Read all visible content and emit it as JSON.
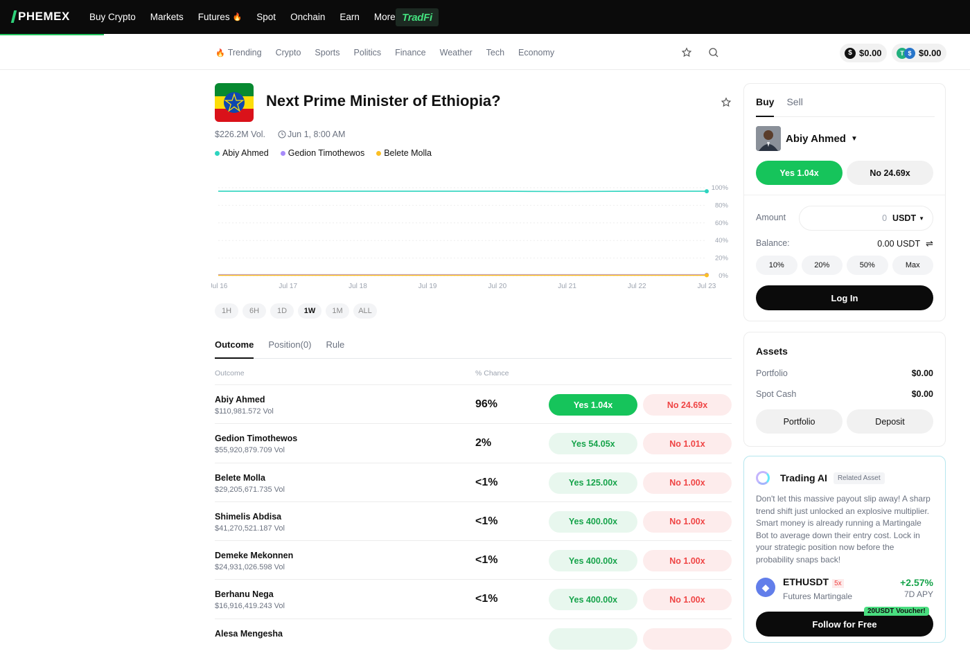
{
  "topnav": {
    "logo": "PHEMEX",
    "links": [
      "Buy Crypto",
      "Markets",
      "Futures",
      "Spot",
      "Onchain",
      "Earn",
      "More"
    ],
    "tradfi": "TradFi"
  },
  "subnav": {
    "categories": [
      "Trending",
      "Crypto",
      "Sports",
      "Politics",
      "Finance",
      "Weather",
      "Tech",
      "Economy"
    ],
    "balance1": "$0.00",
    "balance2": "$0.00"
  },
  "market": {
    "title": "Next Prime Minister of Ethiopia?",
    "volume": "$226.2M Vol.",
    "end_date": "Jun 1, 8:00 AM",
    "legend": [
      {
        "name": "Abiy Ahmed",
        "color": "#2dd4bf"
      },
      {
        "name": "Gedion Timothewos",
        "color": "#a78bfa"
      },
      {
        "name": "Belete Molla",
        "color": "#fbbf24"
      }
    ]
  },
  "chart_data": {
    "type": "line",
    "x": [
      "Jul 16",
      "Jul 17",
      "Jul 18",
      "Jul 19",
      "Jul 20",
      "Jul 21",
      "Jul 22",
      "Jul 23"
    ],
    "ylim": [
      0,
      100
    ],
    "yticks": [
      "100%",
      "80%",
      "60%",
      "40%",
      "20%",
      "0%"
    ],
    "series": [
      {
        "name": "Abiy Ahmed",
        "color": "#2dd4bf",
        "values": [
          96,
          96,
          96,
          96,
          96,
          96,
          96,
          96
        ]
      },
      {
        "name": "Gedion Timothewos",
        "color": "#a78bfa",
        "values": [
          1,
          1,
          1,
          1,
          1,
          1,
          1,
          1
        ]
      },
      {
        "name": "Belete Molla",
        "color": "#fbbf24",
        "values": [
          0.5,
          0.5,
          0.5,
          0.5,
          0.5,
          0.5,
          0.5,
          0.5
        ]
      }
    ]
  },
  "ranges": [
    "1H",
    "6H",
    "1D",
    "1W",
    "1M",
    "ALL"
  ],
  "active_range": "1W",
  "tabs": [
    "Outcome",
    "Position(0)",
    "Rule"
  ],
  "table": {
    "headers": [
      "Outcome",
      "% Chance"
    ],
    "rows": [
      {
        "name": "Abiy Ahmed",
        "vol": "$110,981.572 Vol",
        "chance": "96%",
        "yes": "Yes 1.04x",
        "no": "No 24.69x"
      },
      {
        "name": "Gedion Timothewos",
        "vol": "$55,920,879.709 Vol",
        "chance": "2%",
        "yes": "Yes 54.05x",
        "no": "No 1.01x"
      },
      {
        "name": "Belete Molla",
        "vol": "$29,205,671.735 Vol",
        "chance": "<1%",
        "yes": "Yes 125.00x",
        "no": "No 1.00x"
      },
      {
        "name": "Shimelis Abdisa",
        "vol": "$41,270,521.187 Vol",
        "chance": "<1%",
        "yes": "Yes 400.00x",
        "no": "No 1.00x"
      },
      {
        "name": "Demeke Mekonnen",
        "vol": "$24,931,026.598 Vol",
        "chance": "<1%",
        "yes": "Yes 400.00x",
        "no": "No 1.00x"
      },
      {
        "name": "Berhanu Nega",
        "vol": "$16,916,419.243 Vol",
        "chance": "<1%",
        "yes": "Yes 400.00x",
        "no": "No 1.00x"
      },
      {
        "name": "Alesa Mengesha",
        "vol": "",
        "chance": "",
        "yes": "",
        "no": ""
      }
    ]
  },
  "trade": {
    "tabs": [
      "Buy",
      "Sell"
    ],
    "candidate": "Abiy Ahmed",
    "yes": "Yes 1.04x",
    "no": "No 24.69x",
    "amount_label": "Amount",
    "amount_value": "0",
    "amount_unit": "USDT",
    "balance_label": "Balance:",
    "balance_value": "0.00 USDT",
    "percents": [
      "10%",
      "20%",
      "50%",
      "Max"
    ],
    "login": "Log In"
  },
  "assets": {
    "title": "Assets",
    "portfolio_label": "Portfolio",
    "portfolio_value": "$0.00",
    "spot_label": "Spot Cash",
    "spot_value": "$0.00",
    "btn_portfolio": "Portfolio",
    "btn_deposit": "Deposit"
  },
  "ai": {
    "title": "Trading AI",
    "tag": "Related Asset",
    "text": "Don't let this massive payout slip away! A sharp trend shift just unlocked an explosive multiplier. Smart money is already running a Martingale Bot to average down their entry cost. Lock in your strategic position now before the probability snaps back!",
    "pair": "ETHUSDT",
    "leverage": "5x",
    "strategy": "Futures Martingale",
    "apy_pct": "+2.57%",
    "apy_label": "7D APY",
    "voucher": "20USDT Voucher!",
    "follow": "Follow for Free"
  }
}
